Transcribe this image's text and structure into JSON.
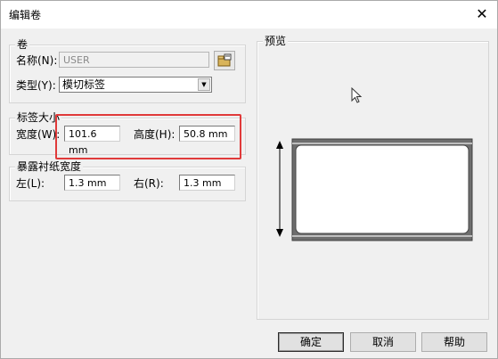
{
  "window": {
    "title": "编辑卷",
    "close_glyph": "✕"
  },
  "volume_group": {
    "legend": "卷",
    "name_label": "名称(N):",
    "name_value": "USER",
    "type_label": "类型(Y):",
    "type_value": "模切标签"
  },
  "label_size_group": {
    "legend": "标签大小",
    "width_label": "宽度(W):",
    "width_value": "101.6 mm",
    "height_label": "高度(H):",
    "height_value": "50.8 mm"
  },
  "liner_group": {
    "legend": "暴露衬纸宽度",
    "left_label": "左(L):",
    "left_value": "1.3 mm",
    "right_label": "右(R):",
    "right_value": "1.3 mm"
  },
  "preview_group": {
    "legend": "预览"
  },
  "buttons": {
    "ok": "确定",
    "cancel": "取消",
    "help": "帮助"
  },
  "icons": [
    "browse-icon",
    "dropdown-arrow-icon",
    "mouse-cursor-icon",
    "dimension-arrow-icon"
  ],
  "colors": {
    "highlight": "#e03a3a",
    "preview_border": "#4a4a4a"
  }
}
